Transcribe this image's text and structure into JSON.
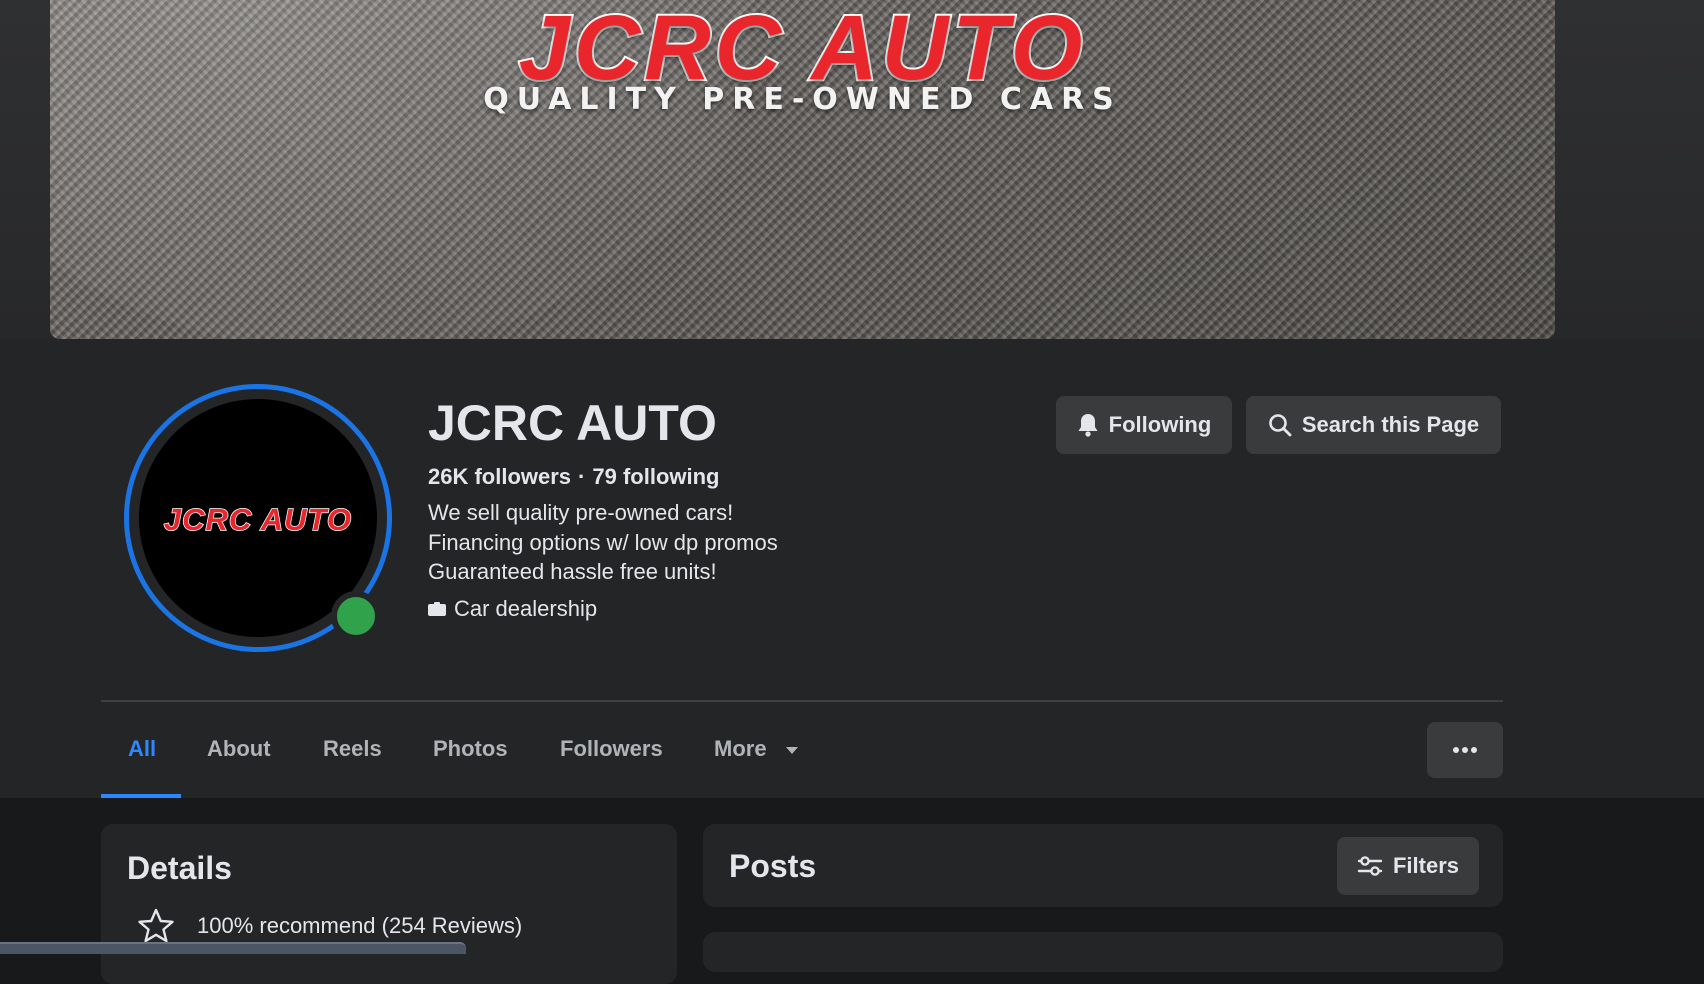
{
  "cover": {
    "title": "JCRC AUTO",
    "subtitle": "QUALITY PRE-OWNED CARS"
  },
  "profile": {
    "avatar_text": "JCRC AUTO",
    "name": "JCRC AUTO",
    "followers": "26K followers",
    "separator": "·",
    "following": "79 following",
    "bio": [
      "We sell quality pre-owned cars!",
      "Financing options w/ low dp promos",
      "Guaranteed hassle free units!"
    ],
    "category": "Car dealership",
    "online_status_color": "#31a24c"
  },
  "actions": {
    "following_label": "Following",
    "search_label": "Search this Page"
  },
  "tabs": [
    {
      "label": "All",
      "active": true
    },
    {
      "label": "About",
      "active": false
    },
    {
      "label": "Reels",
      "active": false
    },
    {
      "label": "Photos",
      "active": false
    },
    {
      "label": "Followers",
      "active": false
    },
    {
      "label": "More",
      "active": false
    }
  ],
  "details": {
    "title": "Details",
    "recommend": "100% recommend (254 Reviews)"
  },
  "posts": {
    "title": "Posts",
    "filters_label": "Filters"
  },
  "colors": {
    "accent": "#2d88ff",
    "avatar_ring": "#1b74e4",
    "brand_red": "#e8262b",
    "background": "#242526"
  }
}
